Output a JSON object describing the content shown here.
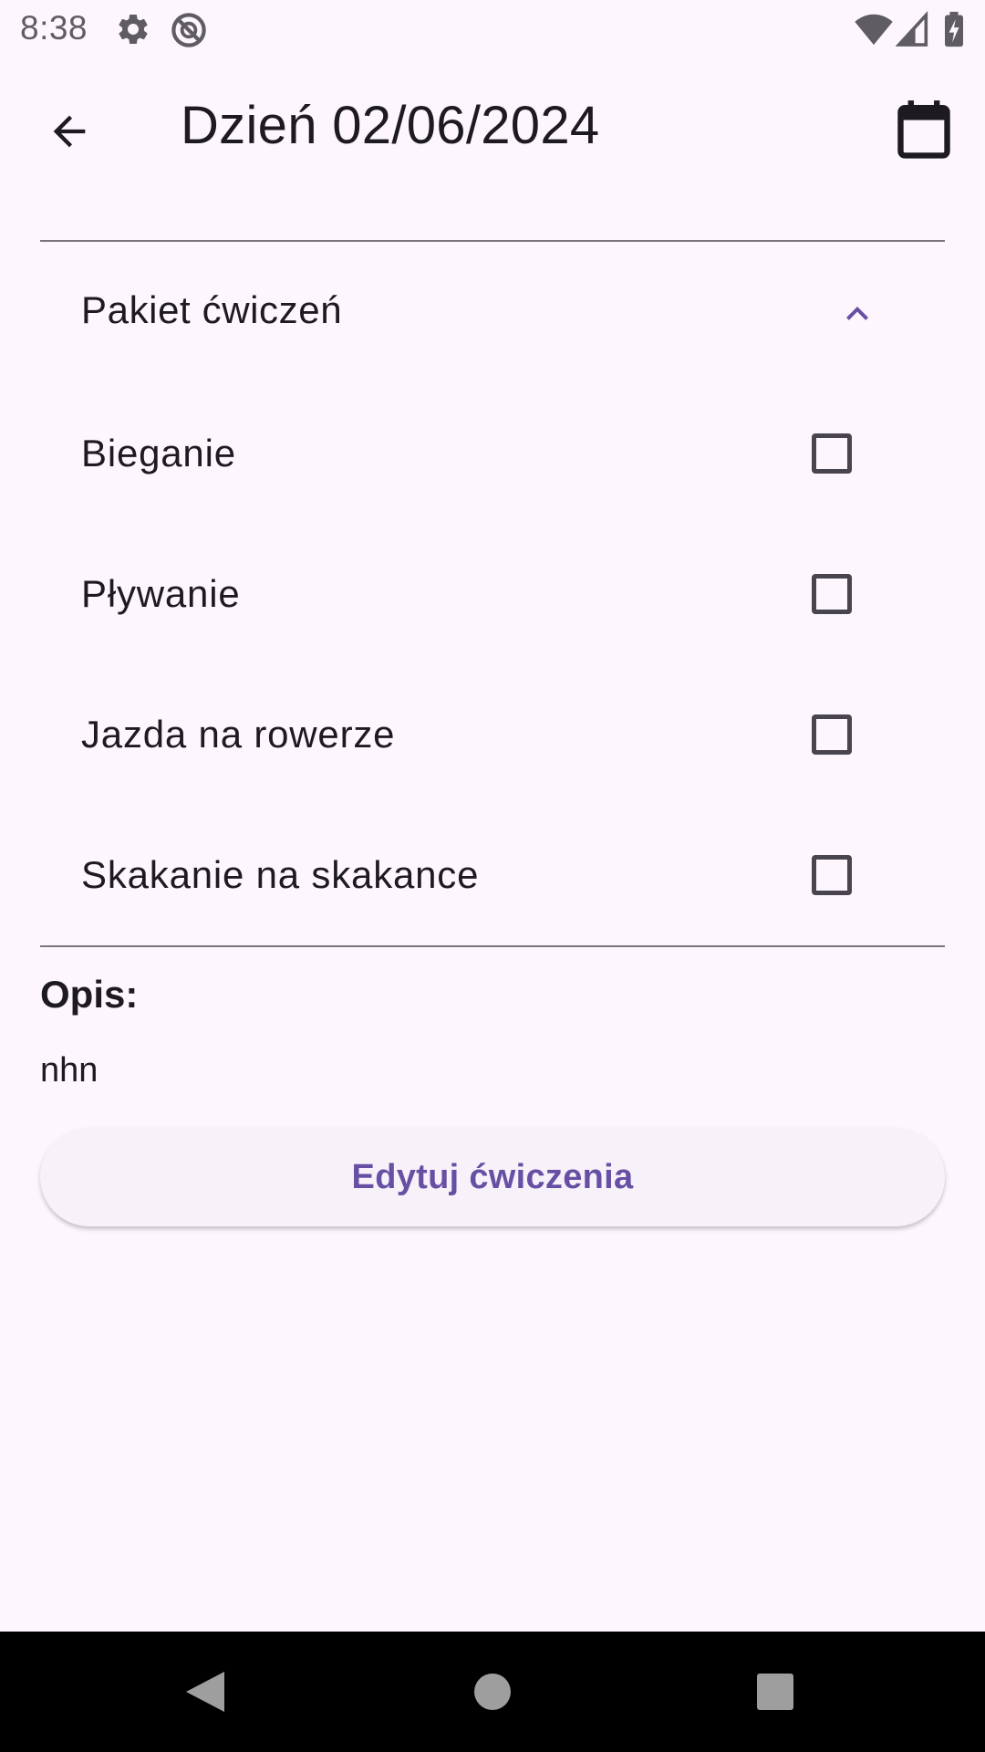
{
  "status_bar": {
    "time": "8:38",
    "icons_left": [
      "gear-icon",
      "do-not-disturb-icon"
    ],
    "icons_right": [
      "wifi-icon",
      "signal-icon",
      "battery-charging-icon"
    ]
  },
  "app_bar": {
    "title": "Dzień 02/06/2024",
    "back_icon": "arrow-back-icon",
    "calendar_icon": "calendar-icon"
  },
  "exercise_package": {
    "label": "Pakiet ćwiczeń",
    "expanded": true,
    "items": [
      {
        "label": "Bieganie",
        "checked": false
      },
      {
        "label": "Pływanie",
        "checked": false
      },
      {
        "label": "Jazda na rowerze",
        "checked": false
      },
      {
        "label": "Skakanie na skakance",
        "checked": false
      }
    ]
  },
  "description": {
    "label": "Opis:",
    "value": "nhn"
  },
  "edit_button": {
    "label": "Edytuj ćwiczenia"
  },
  "colors": {
    "background": "#fdf7fd",
    "accent": "#6750a4",
    "text": "#1d1b20",
    "divider": "#79747e"
  }
}
